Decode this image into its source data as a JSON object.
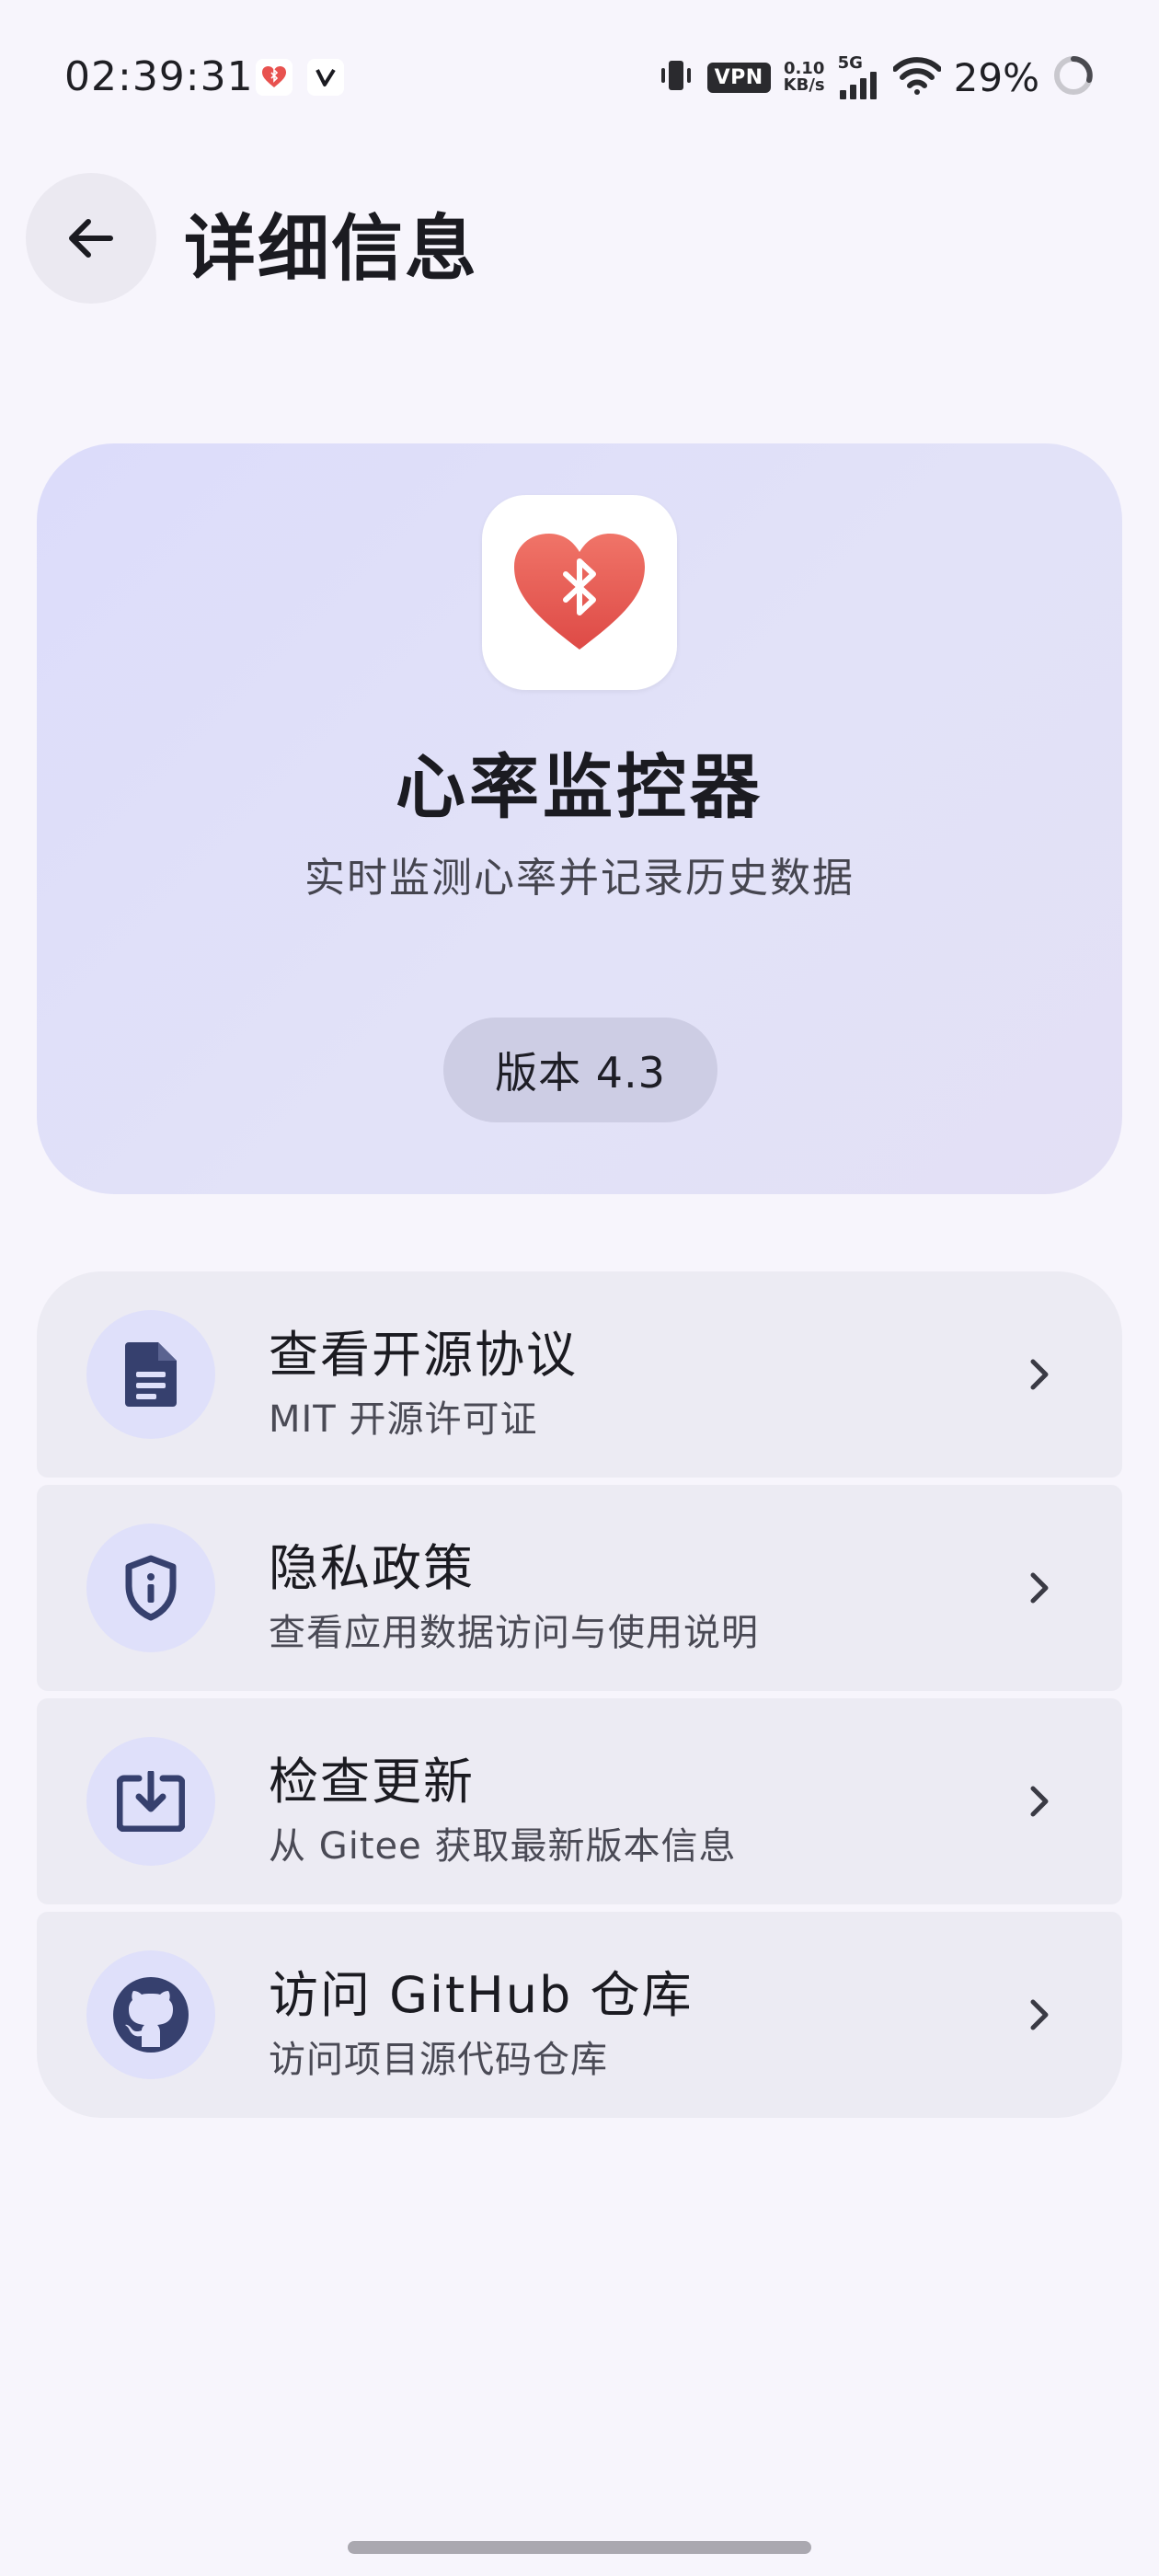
{
  "status_bar": {
    "time": "02:39:31",
    "vpn": "VPN",
    "net_speed_value": "0.10",
    "net_speed_unit": "KB/s",
    "network_type": "5G",
    "battery_percent": "29%"
  },
  "app_bar": {
    "title": "详细信息"
  },
  "hero": {
    "app_name": "心率监控器",
    "description": "实时监测心率并记录历史数据",
    "version": "版本 4.3"
  },
  "list": {
    "items": [
      {
        "title": "查看开源协议",
        "subtitle": "MIT 开源许可证",
        "icon": "document-icon"
      },
      {
        "title": "隐私政策",
        "subtitle": "查看应用数据访问与使用说明",
        "icon": "shield-info-icon"
      },
      {
        "title": "检查更新",
        "subtitle": "从 Gitee 获取最新版本信息",
        "icon": "download-box-icon"
      },
      {
        "title": "访问 GitHub 仓库",
        "subtitle": "访问项目源代码仓库",
        "icon": "github-icon"
      }
    ]
  },
  "colors": {
    "background": "#f7f5fc",
    "hero_card": "#dcdcfa",
    "list_item": "#ecebf3",
    "icon_circle": "#dfe0fa",
    "icon_glyph": "#36406e",
    "heart_red": "#e8524f"
  }
}
